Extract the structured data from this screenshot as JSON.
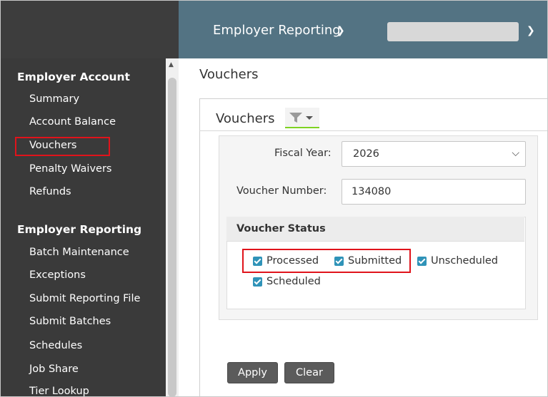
{
  "header": {
    "nav_title": "Employer Reporting",
    "nav_chevron_icon": "chevron-down-icon",
    "org_select_chevron_icon": "chevron-down-icon"
  },
  "sidebar": {
    "sections": [
      {
        "title": "Employer Account",
        "items": [
          "Summary",
          "Account Balance",
          "Vouchers",
          "Penalty Waivers",
          "Refunds"
        ]
      },
      {
        "title": "Employer Reporting",
        "items": [
          "Batch Maintenance",
          "Exceptions",
          "Submit Reporting File",
          "Submit Batches",
          "Schedules",
          "Job Share",
          "Tier Lookup"
        ]
      }
    ],
    "active_item": "Vouchers"
  },
  "main": {
    "page_title": "Vouchers",
    "panel_title": "Vouchers",
    "filter_icon": "filter-icon",
    "form": {
      "fiscal_year_label": "Fiscal Year:",
      "fiscal_year_value": "2026",
      "voucher_number_label": "Voucher Number:",
      "voucher_number_value": "134080",
      "status_header": "Voucher Status",
      "statuses": [
        {
          "label": "Processed",
          "checked": true
        },
        {
          "label": "Submitted",
          "checked": true
        },
        {
          "label": "Unscheduled",
          "checked": true
        },
        {
          "label": "Scheduled",
          "checked": true
        }
      ]
    },
    "buttons": {
      "apply": "Apply",
      "clear": "Clear"
    }
  },
  "colors": {
    "header_bg": "#537383",
    "sidebar_bg": "#3a3a3a",
    "highlight": "#e0131b",
    "checkbox": "#2f93b8",
    "button_bg": "#5b5b5b",
    "filter_underline": "#7ed321"
  }
}
